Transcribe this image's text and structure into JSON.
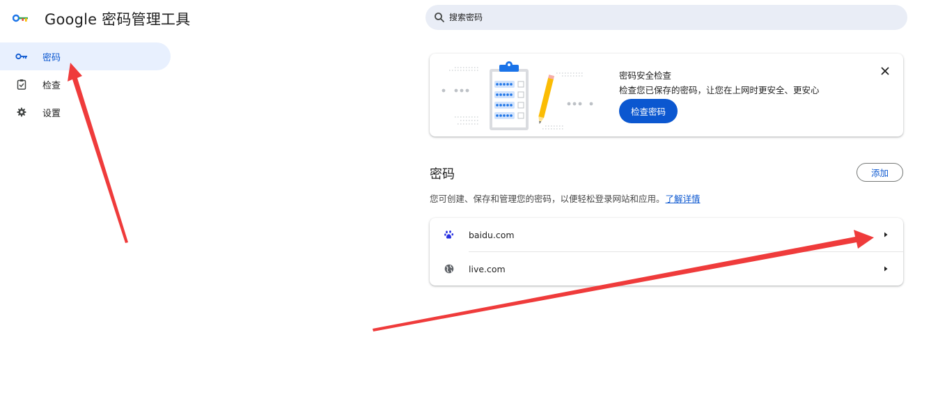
{
  "header": {
    "title": "Google 密码管理工具",
    "logo_icon": "key-logo-icon"
  },
  "search": {
    "placeholder": "搜索密码",
    "icon": "search-icon"
  },
  "sidebar": {
    "items": [
      {
        "label": "密码",
        "icon": "key-icon",
        "active": true
      },
      {
        "label": "检查",
        "icon": "clipboard-check-icon",
        "active": false
      },
      {
        "label": "设置",
        "icon": "gear-icon",
        "active": false
      }
    ]
  },
  "checkup": {
    "title": "密码安全检查",
    "description": "检查您已保存的密码，让您在上网时更安全、更安心",
    "button_label": "检查密码",
    "close_icon": "close-icon"
  },
  "passwords": {
    "title": "密码",
    "add_label": "添加",
    "description": "您可创建、保存和管理您的密码，以便轻松登录网站和应用。",
    "learn_more": "了解详情",
    "items": [
      {
        "site": "baidu.com",
        "icon": "baidu-paw-icon"
      },
      {
        "site": "live.com",
        "icon": "globe-icon"
      }
    ]
  },
  "colors": {
    "accent": "#0b57d0",
    "active_bg": "#e8f0fe",
    "search_bg": "#e9edf6",
    "annotation_arrow": "#ef3b3b"
  }
}
